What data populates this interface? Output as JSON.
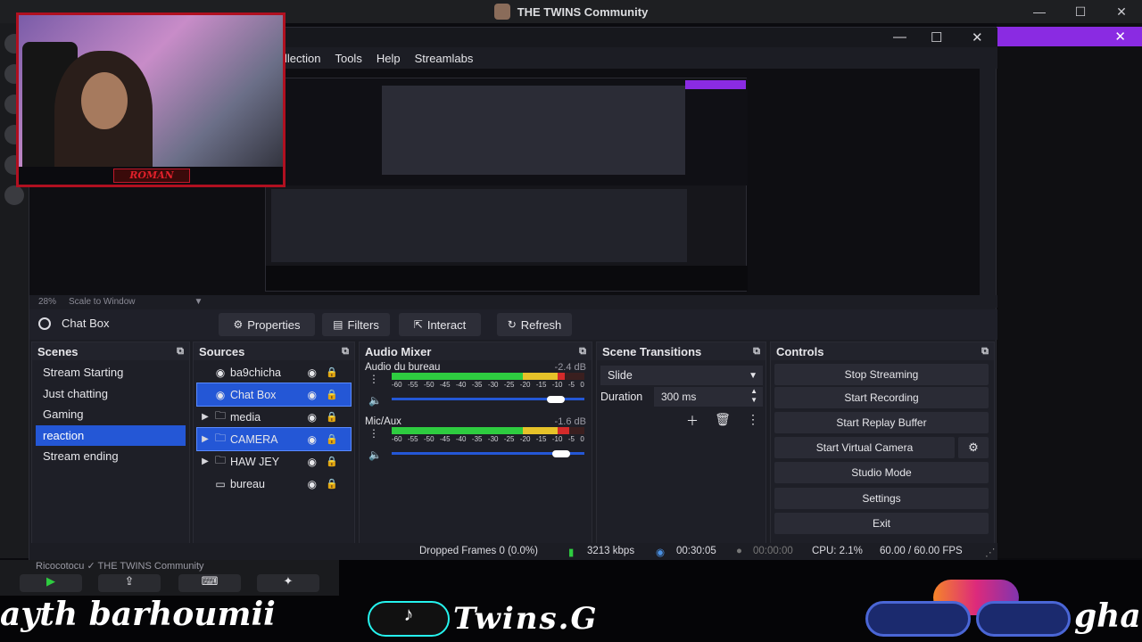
{
  "window": {
    "title": "THE TWINS Community",
    "controls": {
      "minimize": "—",
      "maximize": "☐",
      "close": "✕"
    }
  },
  "obs": {
    "title_controls": {
      "minimize": "—",
      "maximize": "☐",
      "close": "✕"
    },
    "menu": [
      "llection",
      "Tools",
      "Help",
      "Streamlabs"
    ],
    "preview": {
      "zoom": "28%",
      "scale_mode": "Scale to Window"
    },
    "source_toolbar": {
      "selected_source": "Chat Box",
      "buttons": {
        "properties": "Properties",
        "filters": "Filters",
        "interact": "Interact",
        "refresh": "Refresh"
      }
    },
    "scenes": {
      "title": "Scenes",
      "items": [
        "Stream Starting",
        "Just chatting",
        "Gaming",
        "reaction",
        "Stream ending"
      ],
      "selected_index": 3
    },
    "sources": {
      "title": "Sources",
      "items": [
        {
          "name": "ba9chicha",
          "type": "browser",
          "expand": ""
        },
        {
          "name": "Chat Box",
          "type": "browser",
          "expand": ""
        },
        {
          "name": "media",
          "type": "folder",
          "expand": "▶"
        },
        {
          "name": "CAMERA",
          "type": "folder",
          "expand": "▶"
        },
        {
          "name": "HAW JEY",
          "type": "folder",
          "expand": "▶"
        },
        {
          "name": "bureau",
          "type": "display",
          "expand": ""
        }
      ],
      "selected": [
        1,
        3
      ]
    },
    "audio_mixer": {
      "title": "Audio Mixer",
      "ticks": [
        "-60",
        "-55",
        "-50",
        "-45",
        "-40",
        "-35",
        "-30",
        "-25",
        "-20",
        "-15",
        "-10",
        "-5",
        "0"
      ],
      "channels": [
        {
          "name": "Audio du bureau",
          "db": "-2.4 dB",
          "level": 0.9,
          "volume": 0.85
        },
        {
          "name": "Mic/Aux",
          "db": "-1.6 dB",
          "level": 0.92,
          "volume": 0.88
        }
      ]
    },
    "transitions": {
      "title": "Scene Transitions",
      "type": "Slide",
      "duration_label": "Duration",
      "duration_value": "300 ms"
    },
    "controls": {
      "title": "Controls",
      "buttons": [
        "Stop Streaming",
        "Start Recording",
        "Start Replay Buffer",
        "Start Virtual Camera",
        "Studio Mode",
        "Settings",
        "Exit"
      ]
    },
    "status": {
      "dropped": "Dropped Frames 0 (0.0%)",
      "bitrate": "3213 kbps",
      "stream_time": "00:30:05",
      "rec_time": "00:00:00",
      "cpu": "CPU: 2.1%",
      "fps": "60.00 / 60.00 FPS"
    }
  },
  "overlay": {
    "cam_name": "ROMAN",
    "discord_label": "Ricocotocu ✓ THE TWINS Community",
    "name_text": "ayth barhoumii",
    "twins_text": "Twins.G",
    "gh_text": "gha",
    "tiktok_glyph": "♪"
  },
  "colors": {
    "accent": "#2457d6",
    "purple": "#8a2be2",
    "meter_green": "#2ecc40",
    "meter_yellow": "#e6c229",
    "meter_red": "#d42a2a"
  }
}
